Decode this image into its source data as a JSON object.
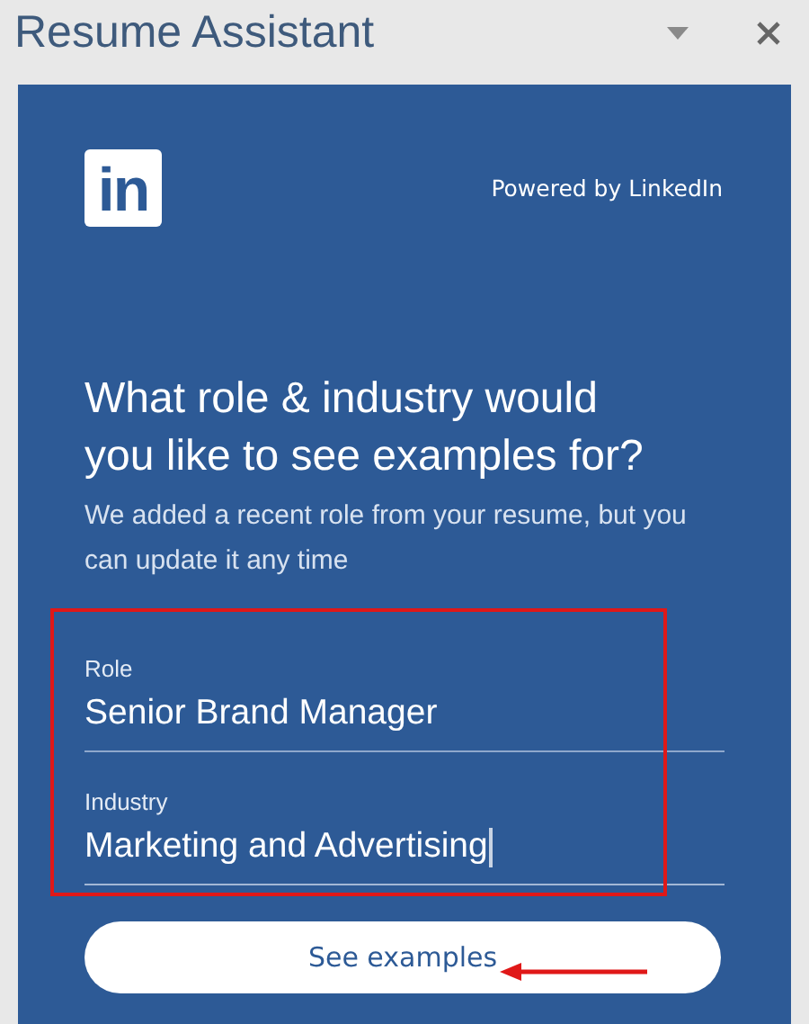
{
  "pane": {
    "title": "Resume Assistant"
  },
  "header": {
    "logo": "in",
    "powered_by": "Powered by LinkedIn"
  },
  "heading": "What role & industry would you like to see examples for?",
  "description": "We added a recent role from your resume, but you can update it any time",
  "fields": [
    {
      "label": "Role",
      "value": "Senior Brand Manager",
      "focused": false
    },
    {
      "label": "Industry",
      "value": "Marketing and Advertising",
      "focused": true
    }
  ],
  "button": "See examples"
}
